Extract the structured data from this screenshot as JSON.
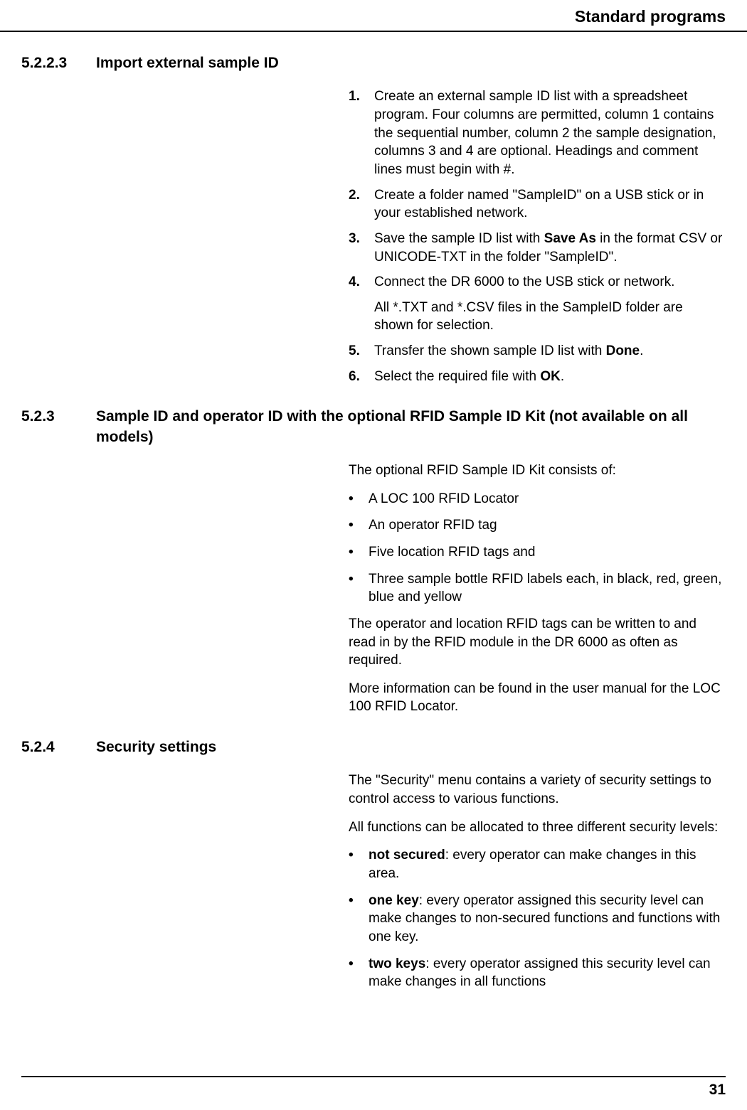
{
  "header": {
    "title": "Standard programs"
  },
  "s1": {
    "num": "5.2.2.3",
    "title": "Import external sample ID",
    "steps": {
      "n1": "1.",
      "t1": "Create an external sample ID list with a spreadsheet program. Four columns are permitted, column 1 contains the sequential number, column 2 the sample designation, columns 3 and 4 are optional. Headings and comment lines must begin with #.",
      "n2": "2.",
      "t2": "Create a folder named \"SampleID\" on a USB stick or in your established network.",
      "n3": "3.",
      "t3a": "Save the sample ID list with ",
      "t3b": "Save As",
      "t3c": " in the format CSV or UNICODE-TXT in the folder \"SampleID\".",
      "n4": "4.",
      "t4": "Connect the DR 6000 to the USB stick or network.",
      "t4sub": "All *.TXT and *.CSV files in the SampleID folder are shown for selection.",
      "n5": "5.",
      "t5a": "Transfer the shown sample ID list with ",
      "t5b": "Done",
      "t5c": ".",
      "n6": "6.",
      "t6a": "Select the required file with ",
      "t6b": "OK",
      "t6c": "."
    }
  },
  "s2": {
    "num": "5.2.3",
    "title": "Sample ID and operator ID with the optional RFID Sample ID Kit (not available on all models)",
    "intro": "The optional RFID Sample ID Kit consists of:",
    "bullets": {
      "b1": "A LOC 100 RFID Locator",
      "b2": "An operator RFID tag",
      "b3": "Five location RFID tags and",
      "b4": "Three sample bottle RFID labels each, in black, red, green, blue and yellow"
    },
    "p1": "The operator and location RFID tags can be written to and read in by the RFID module in the DR 6000 as often as required.",
    "p2": "More information can be found in the user manual for the LOC 100 RFID Locator."
  },
  "s3": {
    "num": "5.2.4",
    "title": "Security settings",
    "p1": "The \"Security\" menu contains a variety of security settings to control access to various functions.",
    "p2": "All functions can be allocated to three different security levels:",
    "bullets": {
      "b1_bold": "not secured",
      "b1_rest": ": every operator can make changes in this area.",
      "b2_bold": "one key",
      "b2_rest": ": every operator assigned this security level can make changes to non-secured functions and functions with one key.",
      "b3_bold": "two keys",
      "b3_rest": ": every operator assigned this security level can make changes in all functions"
    }
  },
  "footer": {
    "page": "31"
  }
}
